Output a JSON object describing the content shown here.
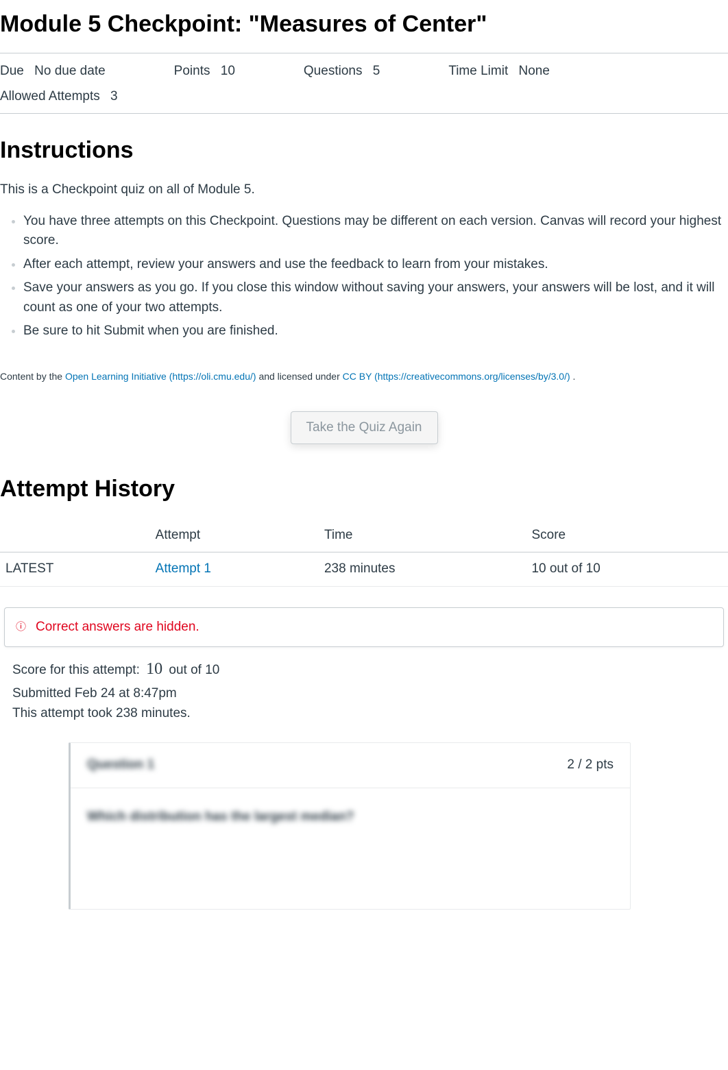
{
  "page_title": "Module 5 Checkpoint: \"Measures of Center\"",
  "meta": {
    "due_label": "Due",
    "due_value": "No due date",
    "points_label": "Points",
    "points_value": "10",
    "questions_label": "Questions",
    "questions_value": "5",
    "time_limit_label": "Time Limit",
    "time_limit_value": "None",
    "attempts_label": "Allowed Attempts",
    "attempts_value": "3"
  },
  "instructions_heading": "Instructions",
  "intro_text": "This is a Checkpoint quiz on all of Module 5.",
  "instruction_items": [
    "You have three attempts on this Checkpoint. Questions may be different on each version. Canvas will record your highest score.",
    "After each attempt, review your answers and use the feedback to learn from your mistakes.",
    "Save your answers as you go. If you close this window without saving your answers, your answers will be lost, and it will count as one of your two attempts.",
    "Be sure to hit Submit when you are finished."
  ],
  "attribution": {
    "prefix": "Content by the",
    "oli_name": "Open Learning Initiative",
    "oli_url": "(https://oli.cmu.edu/)",
    "mid": "and licensed under",
    "cc_name": "CC BY",
    "cc_url": "(https://creativecommons.org/licenses/by/3.0/)",
    "suffix": "."
  },
  "take_again_label": "Take the Quiz Again",
  "history_heading": "Attempt History",
  "history_headers": {
    "blank": "",
    "attempt": "Attempt",
    "time": "Time",
    "score": "Score"
  },
  "history_rows": [
    {
      "latest_label": "LATEST",
      "attempt_label": "Attempt 1",
      "time": "238 minutes",
      "score": "10 out of 10"
    }
  ],
  "alert": {
    "icon": "ⓘ",
    "text": "Correct answers are hidden."
  },
  "score_block": {
    "label": "Score for this attempt:",
    "value": "10",
    "suffix": "out of 10",
    "submitted": "Submitted Feb 24 at 8:47pm",
    "took": "This attempt took 238 minutes."
  },
  "question": {
    "title": "Question 1",
    "pts": "2 / 2 pts",
    "stem": "Which distribution has the largest median?"
  }
}
